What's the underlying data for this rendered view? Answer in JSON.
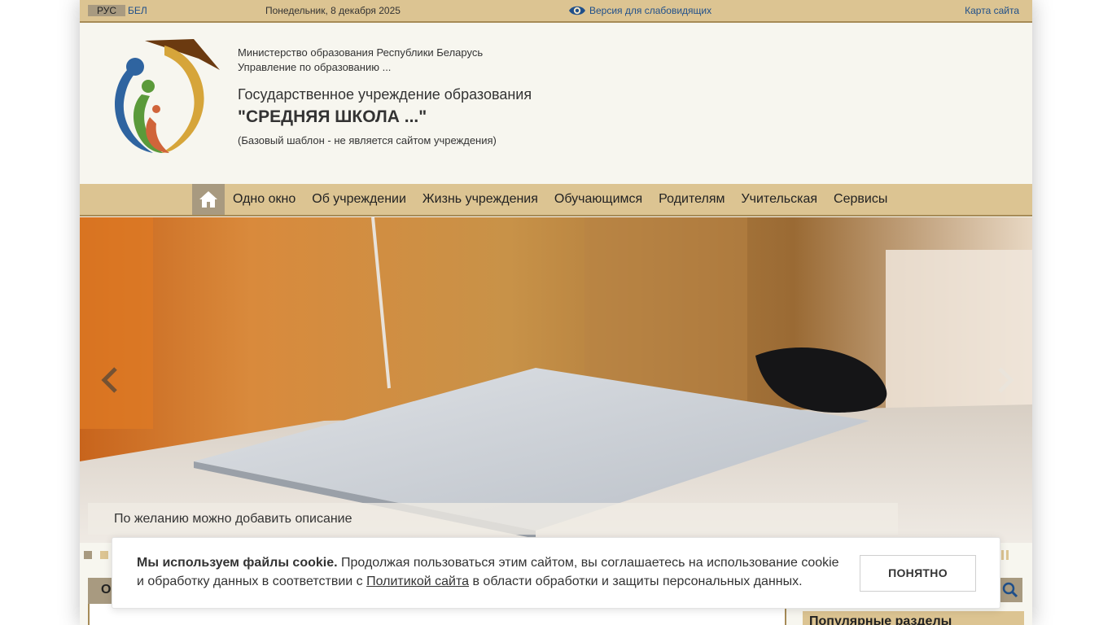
{
  "topbar": {
    "lang_ru": "РУС",
    "lang_by": "БЕЛ",
    "date": "Понедельник, 8 декабря 2025",
    "vision_label": "Версия для слабовидящих",
    "sitemap_label": "Карта сайта"
  },
  "header": {
    "ministry": "Министерство образования Республики Беларусь",
    "department": "Управление по образованию ...",
    "institution": "Государственное учреждение образования",
    "school_name": "\"СРЕДНЯЯ ШКОЛА ...\"",
    "note": "(Базовый шаблон - не является сайтом учреждения)"
  },
  "nav": {
    "items": [
      {
        "label": "Одно окно"
      },
      {
        "label": "Об учреждении"
      },
      {
        "label": "Жизнь учреждения"
      },
      {
        "label": "Обучающимся"
      },
      {
        "label": "Родителям"
      },
      {
        "label": "Учительская"
      },
      {
        "label": "Сервисы"
      }
    ]
  },
  "slider": {
    "caption": "По желанию можно добавить описание",
    "active_slide": 1,
    "slide_count": 2
  },
  "content": {
    "tab_label": "О",
    "popular_label": "Популярные разделы"
  },
  "cookie": {
    "title": "Мы используем файлы cookie.",
    "text_before_link": " Продолжая пользоваться этим сайтом, вы соглашаетесь на использование cookie и обработку данных в соответствии с ",
    "link": "Политикой сайта",
    "text_after_link": " в области обработки и защиты персональных данных.",
    "button": "ПОНЯТНО"
  },
  "colors": {
    "bar": "#dcc492",
    "bar_dark": "#a89a80",
    "border": "#a68b57",
    "link": "#1f4f8a",
    "page_bg": "#f7f6ef"
  },
  "icons": [
    "eye-icon",
    "home-icon",
    "chevron-left-icon",
    "chevron-right-icon",
    "pause-icon",
    "search-icon",
    "school-logo"
  ]
}
